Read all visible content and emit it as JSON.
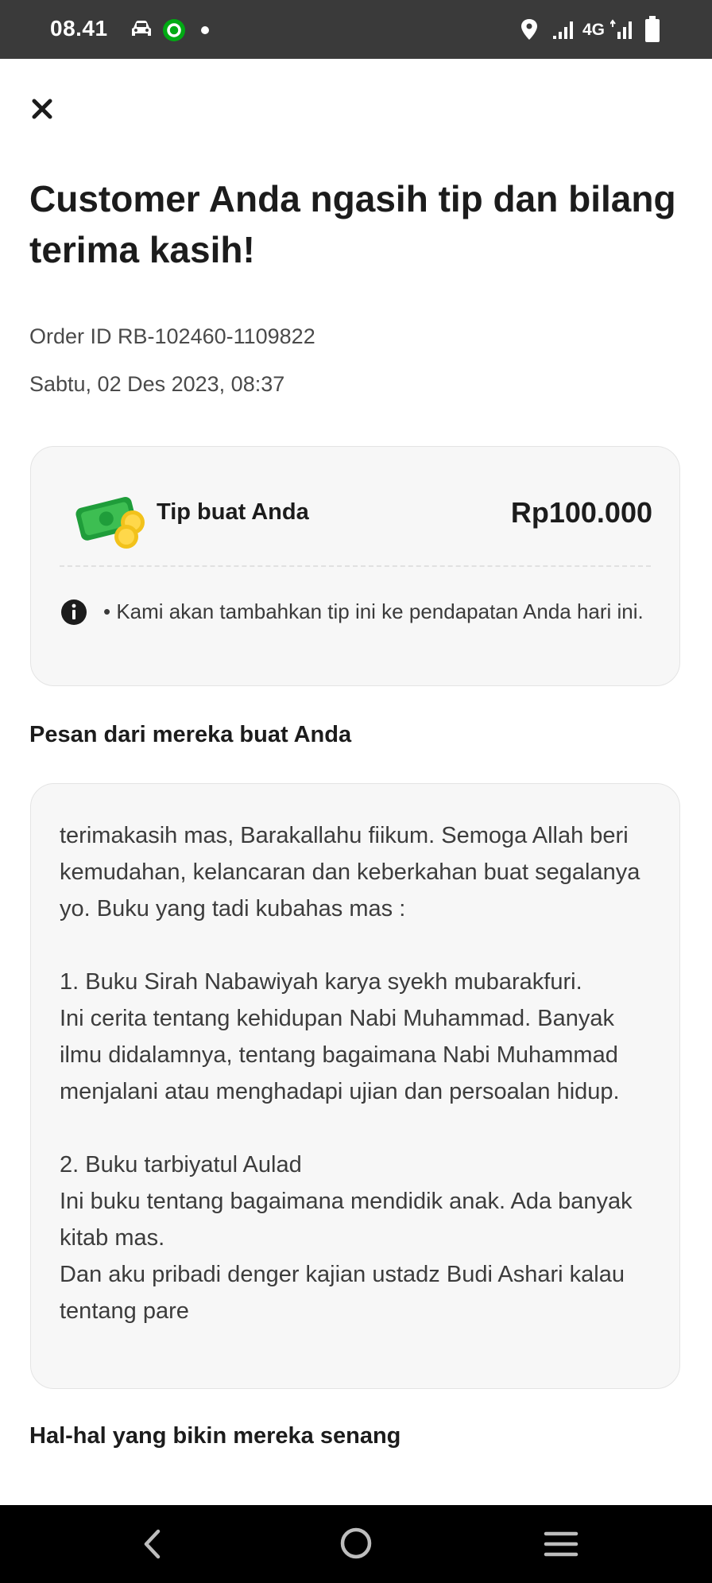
{
  "status_bar": {
    "time": "08.41",
    "network_label": "4G",
    "icons": [
      "car-icon",
      "app-notification-icon",
      "dot-icon",
      "location-icon",
      "signal-icon",
      "signal-4g-icon",
      "battery-icon"
    ]
  },
  "header": {
    "close_icon": "close-icon",
    "title": "Customer Anda ngasih tip dan bilang terima kasih!"
  },
  "order": {
    "id_text": "Order ID RB-102460-1109822",
    "datetime": "Sabtu, 02 Des 2023, 08:37"
  },
  "tip": {
    "icon": "money-coins-icon",
    "label": "Tip buat Anda",
    "amount": "Rp100.000",
    "info_icon": "info-icon",
    "info_text": "• Kami akan tambahkan tip ini ke pendapatan Anda hari ini."
  },
  "message": {
    "section_title": "Pesan dari mereka buat Anda",
    "text": "terimakasih mas, Barakallahu fiikum. Semoga Allah beri kemudahan, kelancaran dan keberkahan buat segalanya yo. Buku yang tadi kubahas mas :\n\n1. Buku Sirah Nabawiyah karya syekh mubarakfuri.\nIni cerita tentang kehidupan Nabi Muhammad. Banyak ilmu didalamnya, tentang bagaimana Nabi Muhammad menjalani atau menghadapi ujian dan persoalan hidup.\n\n2. Buku tarbiyatul Aulad\nIni buku tentang bagaimana mendidik anak. Ada banyak kitab mas.\nDan aku pribadi denger kajian ustadz Budi Ashari kalau tentang pare"
  },
  "likes": {
    "section_title": "Hal-hal yang bikin mereka senang"
  },
  "nav": {
    "icons": [
      "back-icon",
      "home-icon",
      "recents-icon"
    ]
  },
  "colors": {
    "status_bar_bg": "#3a3a3a",
    "card_bg": "#f7f7f7",
    "brand_green": "#00aa13",
    "nav_bg": "#000000"
  }
}
